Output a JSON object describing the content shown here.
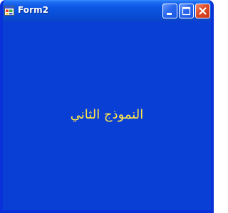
{
  "window": {
    "title": "Form2",
    "accent_color": "#0a3fd6",
    "titlebar_color": "#0b56e4"
  },
  "titlebar": {
    "icon": "form-app-icon",
    "buttons": [
      {
        "name": "minimize",
        "icon": "minimize-icon"
      },
      {
        "name": "maximize",
        "icon": "maximize-icon"
      },
      {
        "name": "close",
        "icon": "close-icon"
      }
    ]
  },
  "client": {
    "label_text": "النموذج الثاني",
    "label_color": "#ffe84a",
    "background_color": "#0a3fd6"
  }
}
